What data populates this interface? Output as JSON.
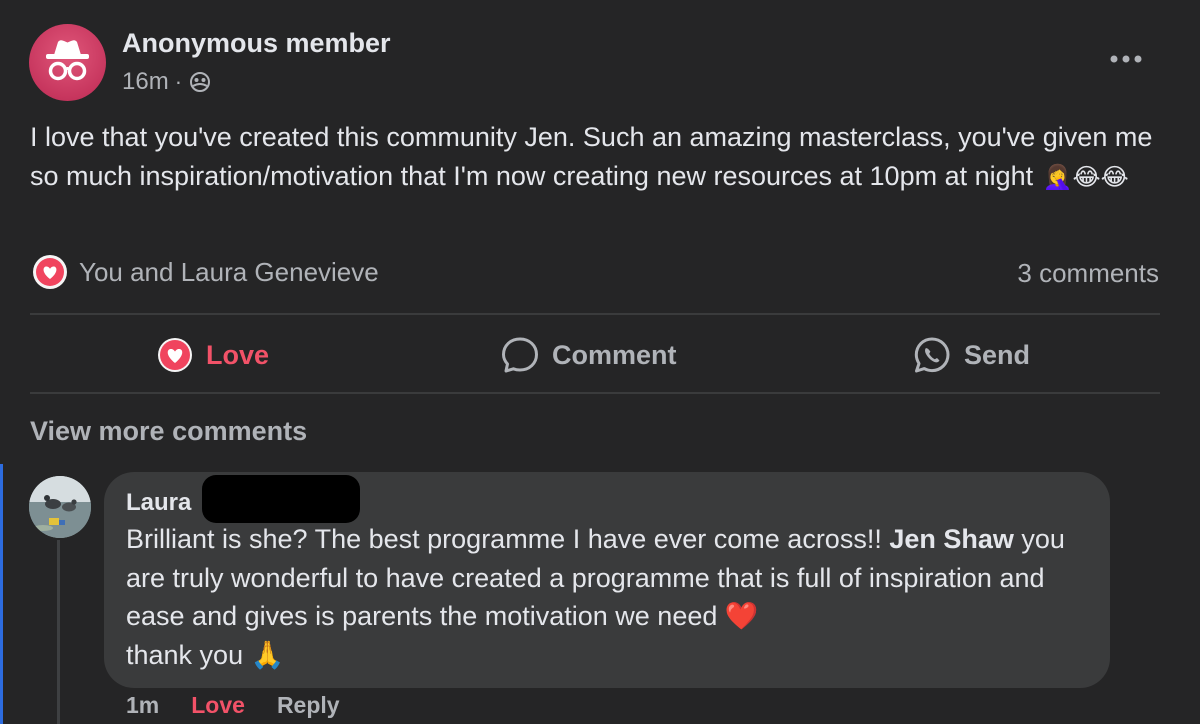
{
  "post": {
    "author": "Anonymous member",
    "time": "16m",
    "separator": "·",
    "privacy_icon": "members-icon",
    "body": "I love that you've created this community Jen. Such an amazing masterclass, you've given me so much inspiration/motivation that I'm now creating new resources at 10pm at night",
    "body_emojis": "🤦‍♀️😂😂",
    "reactions_text": "You and Laura Genevieve",
    "comments_count": "3 comments"
  },
  "actions": {
    "love": "Love",
    "comment": "Comment",
    "send": "Send"
  },
  "view_more": "View more comments",
  "comment": {
    "author": "Laura",
    "text_before": "Brilliant is she? The best programme I have ever come across!! ",
    "mention": "Jen Shaw",
    "text_after": " you are truly wonderful to have created a programme that is full of inspiration and ease and gives is parents the motivation we need ",
    "heart": "❤️",
    "text_end": "thank you ",
    "pray": "🙏",
    "time": "1m",
    "love": "Love",
    "reply": "Reply"
  },
  "colors": {
    "background": "#252526",
    "bubble": "#3a3b3c",
    "love": "#f25268",
    "muted_text": "#b0b3b8",
    "accent_bar": "#2d6cdf"
  }
}
